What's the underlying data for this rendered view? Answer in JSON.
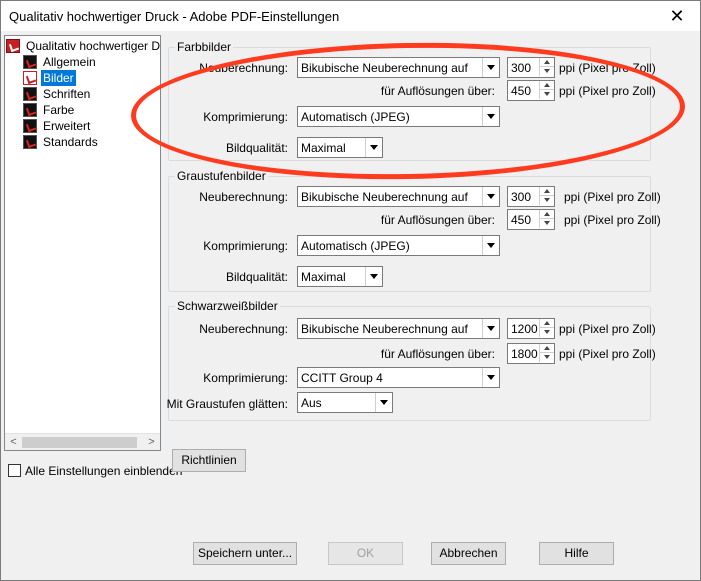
{
  "window": {
    "title": "Qualitativ hochwertiger Druck - Adobe PDF-Einstellungen",
    "close_symbol": "✕"
  },
  "tree": {
    "items": [
      {
        "label": "Qualitativ hochwertiger Druck",
        "icon": "pdf-settings-icon"
      },
      {
        "label": "Allgemein",
        "icon": "pdf-page-icon"
      },
      {
        "label": "Bilder",
        "icon": "pdf-folder-icon"
      },
      {
        "label": "Schriften",
        "icon": "pdf-page-icon"
      },
      {
        "label": "Farbe",
        "icon": "pdf-page-icon"
      },
      {
        "label": "Erweitert",
        "icon": "pdf-page-icon"
      },
      {
        "label": "Standards",
        "icon": "pdf-page-icon"
      }
    ],
    "selected_index": 2,
    "scroll_left": "<",
    "scroll_right": ">"
  },
  "show_all": {
    "label": "Alle Einstellungen einblenden",
    "checked": false
  },
  "groups": {
    "farb": {
      "title": "Farbbilder",
      "resample_label": "Neuberechnung:",
      "resample_value": "Bikubische Neuberechnung auf",
      "resolution": "300",
      "resolution_unit": "ppi (Pixel pro Zoll)",
      "above_label": "für Auflösungen über:",
      "above_value": "450",
      "above_unit": "ppi (Pixel pro Zoll)",
      "compression_label": "Komprimierung:",
      "compression_value": "Automatisch (JPEG)",
      "quality_label": "Bildqualität:",
      "quality_value": "Maximal"
    },
    "grau": {
      "title": "Graustufenbilder",
      "resample_label": "Neuberechnung:",
      "resample_value": "Bikubische Neuberechnung auf",
      "resolution": "300",
      "resolution_unit": "ppi (Pixel pro Zoll)",
      "above_label": "für Auflösungen über:",
      "above_value": "450",
      "above_unit": "ppi (Pixel pro Zoll)",
      "compression_label": "Komprimierung:",
      "compression_value": "Automatisch (JPEG)",
      "quality_label": "Bildqualität:",
      "quality_value": "Maximal"
    },
    "sw": {
      "title": "Schwarzweißbilder",
      "resample_label": "Neuberechnung:",
      "resample_value": "Bikubische Neuberechnung auf",
      "resolution": "1200",
      "resolution_unit": "ppi (Pixel pro Zoll)",
      "above_label": "für Auflösungen über:",
      "above_value": "1800",
      "above_unit": "ppi (Pixel pro Zoll)",
      "compression_label": "Komprimierung:",
      "compression_value": "CCITT Group 4",
      "smooth_label": "Mit Graustufen glätten:",
      "smooth_value": "Aus"
    }
  },
  "buttons": {
    "guidelines": "Richtlinien",
    "save_as": "Speichern unter...",
    "ok": "OK",
    "cancel": "Abbrechen",
    "help": "Hilfe"
  },
  "annotation_color": "#ff3b1f"
}
